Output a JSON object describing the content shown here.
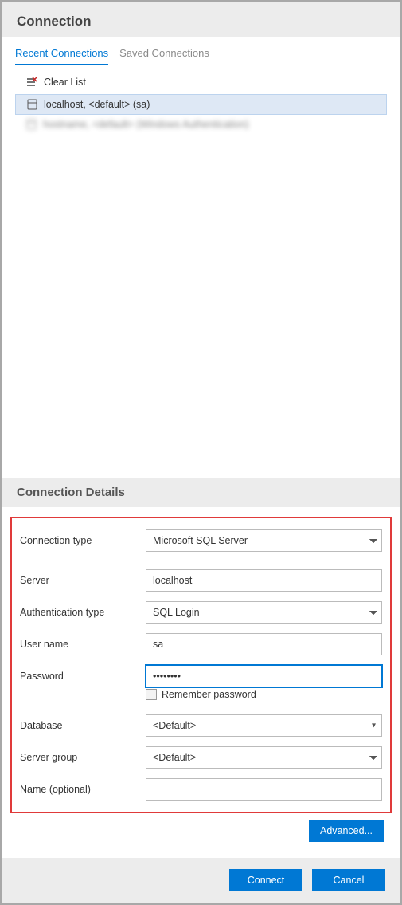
{
  "header": {
    "title": "Connection"
  },
  "tabs": {
    "recent": "Recent Connections",
    "saved": "Saved Connections"
  },
  "clear_list": "Clear List",
  "connections": [
    {
      "label": "localhost, <default> (sa)"
    },
    {
      "label": "hostname, <default> (Windows Authentication)"
    }
  ],
  "details": {
    "title": "Connection Details",
    "fields": {
      "connection_type": {
        "label": "Connection type",
        "value": "Microsoft SQL Server"
      },
      "server": {
        "label": "Server",
        "value": "localhost"
      },
      "auth_type": {
        "label": "Authentication type",
        "value": "SQL Login"
      },
      "user_name": {
        "label": "User name",
        "value": "sa"
      },
      "password": {
        "label": "Password",
        "value": "••••••••"
      },
      "remember": {
        "label": "Remember password"
      },
      "database": {
        "label": "Database",
        "value": "<Default>"
      },
      "server_group": {
        "label": "Server group",
        "value": "<Default>"
      },
      "name_optional": {
        "label": "Name (optional)",
        "value": ""
      }
    },
    "advanced": "Advanced..."
  },
  "footer": {
    "connect": "Connect",
    "cancel": "Cancel"
  }
}
